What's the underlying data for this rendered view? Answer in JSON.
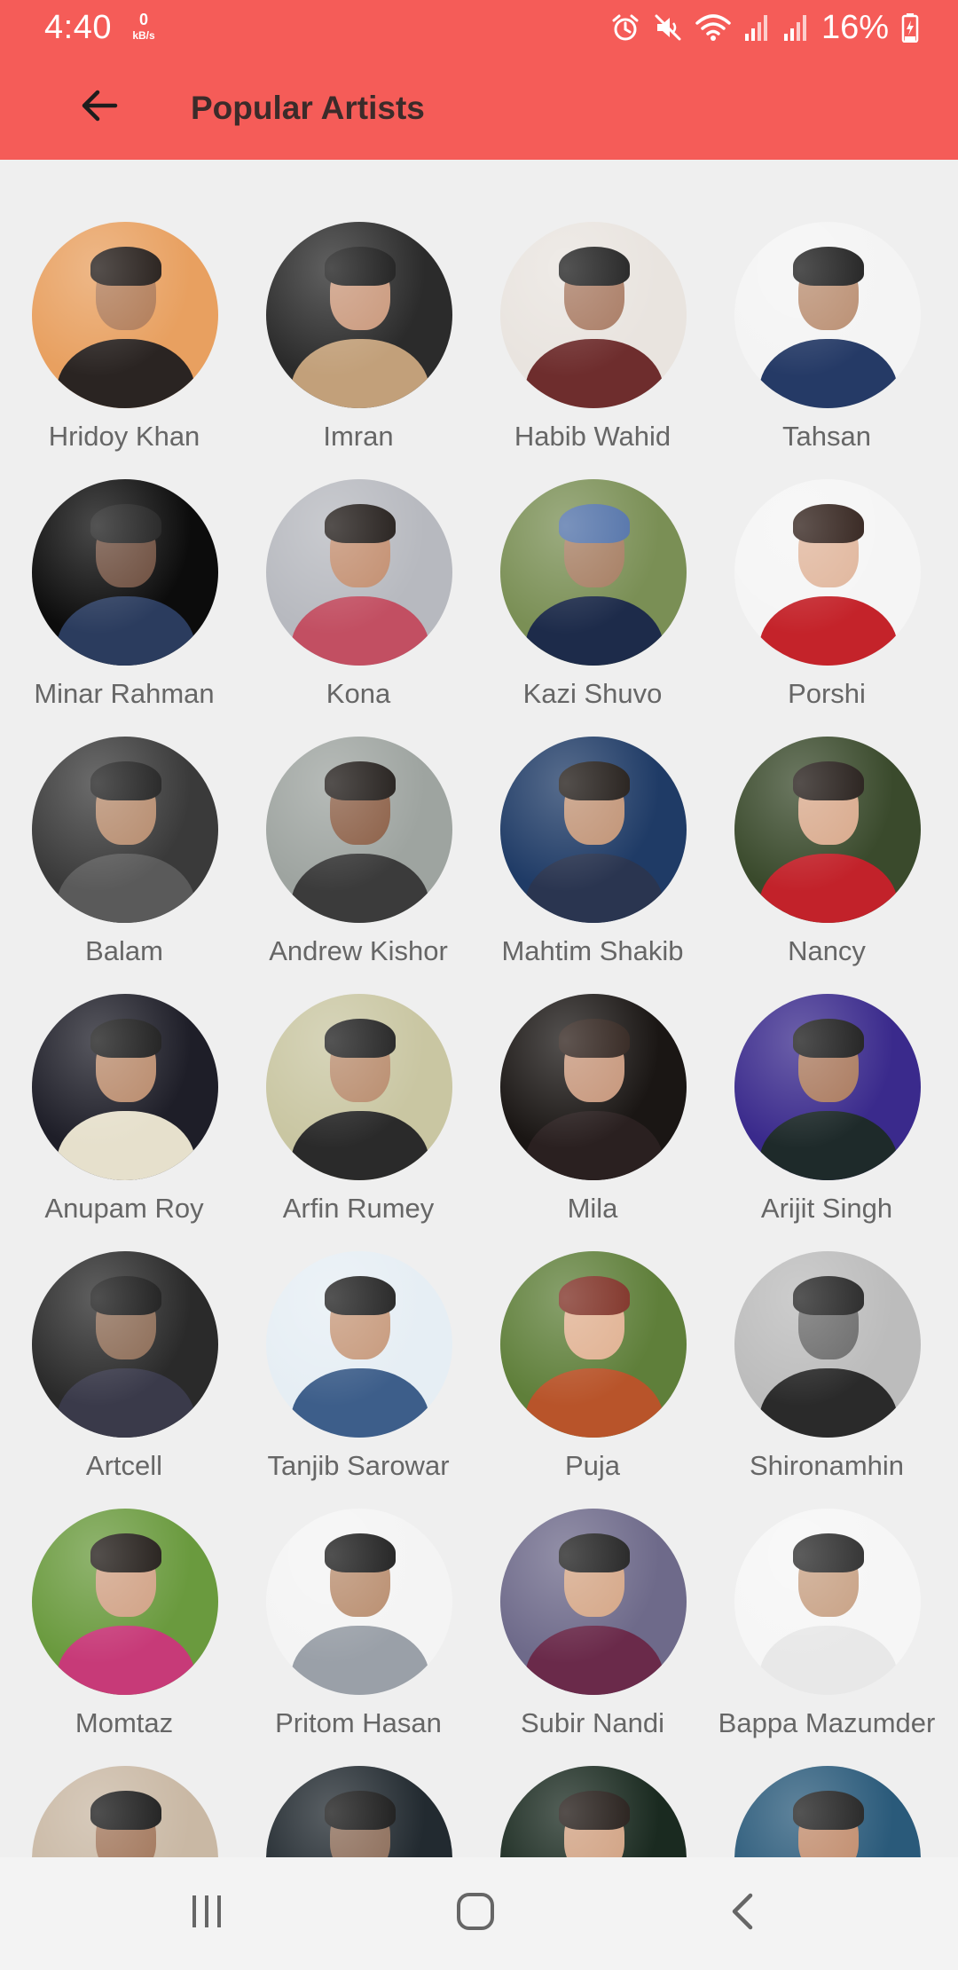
{
  "status_bar": {
    "time": "4:40",
    "net_speed_value": "0",
    "net_speed_unit": "kB/s",
    "battery": "16%",
    "icons": [
      "alarm-icon",
      "mute-icon",
      "wifi-icon",
      "signal-icon",
      "signal-icon",
      "battery-charging-icon"
    ]
  },
  "app_bar": {
    "title": "Popular Artists",
    "back_icon": "arrow-left-icon"
  },
  "artists": [
    {
      "name": "Hridoy Khan",
      "bg": "#e8a060",
      "skin": "#b07a55",
      "hair": "#1c1410",
      "cloth": "#2a2422"
    },
    {
      "name": "Imran",
      "bg": "#2b2b2b",
      "skin": "#c9977a",
      "hair": "#151515",
      "cloth": "#c2a07a"
    },
    {
      "name": "Habib Wahid",
      "bg": "#e9e4df",
      "skin": "#a87a62",
      "hair": "#1a1a1a",
      "cloth": "#6e2d2d"
    },
    {
      "name": "Tahsan",
      "bg": "#f4f4f4",
      "skin": "#b98d70",
      "hair": "#171717",
      "cloth": "#253a66"
    },
    {
      "name": "Minar Rahman",
      "bg": "#0c0c0c",
      "skin": "#6a4a3a",
      "hair": "#1a1a1a",
      "cloth": "#2b3c5e"
    },
    {
      "name": "Kona",
      "bg": "#b7b9bf",
      "skin": "#c28d6e",
      "hair": "#1b1512",
      "cloth": "#c24f62"
    },
    {
      "name": "Kazi Shuvo",
      "bg": "#7a8f55",
      "skin": "#a57c60",
      "hair": "#4d6ea6",
      "cloth": "#1d2b4a"
    },
    {
      "name": "Porshi",
      "bg": "#f5f5f5",
      "skin": "#e0b59b",
      "hair": "#2b1a14",
      "cloth": "#c4232a"
    },
    {
      "name": "Balam",
      "bg": "#3a3a3a",
      "skin": "#b58a6c",
      "hair": "#1a1a1a",
      "cloth": "#5a5a5a"
    },
    {
      "name": "Andrew Kishor",
      "bg": "#9ea4a0",
      "skin": "#8a5d44",
      "hair": "#1a1512",
      "cloth": "#3b3b3b"
    },
    {
      "name": "Mahtim Shakib",
      "bg": "#1f3b66",
      "skin": "#c09274",
      "hair": "#1a1410",
      "cloth": "#2a3550"
    },
    {
      "name": "Nancy",
      "bg": "#3a4a2c",
      "skin": "#d8a88a",
      "hair": "#1c1410",
      "cloth": "#c2222a"
    },
    {
      "name": "Anupam Roy",
      "bg": "#1e1e28",
      "skin": "#b8896a",
      "hair": "#141414",
      "cloth": "#e6e0cc"
    },
    {
      "name": "Arfin Rumey",
      "bg": "#c9c6a2",
      "skin": "#b88b6c",
      "hair": "#1a1a1a",
      "cloth": "#2a2a2a"
    },
    {
      "name": "Mila",
      "bg": "#1a1614",
      "skin": "#c59478",
      "hair": "#2a1c16",
      "cloth": "#2a2020"
    },
    {
      "name": "Arijit Singh",
      "bg": "#3a2a8c",
      "skin": "#a9785c",
      "hair": "#151515",
      "cloth": "#1e2a2a"
    },
    {
      "name": "Artcell",
      "bg": "#2a2a2a",
      "skin": "#8b6a54",
      "hair": "#141414",
      "cloth": "#3a3a4a"
    },
    {
      "name": "Tanjib Sarowar",
      "bg": "#e6eef4",
      "skin": "#c6987a",
      "hair": "#1a1a1a",
      "cloth": "#3d5e8a"
    },
    {
      "name": "Puja",
      "bg": "#5f7f3a",
      "skin": "#e0b090",
      "hair": "#7a2a1e",
      "cloth": "#b8542a"
    },
    {
      "name": "Shironamhin",
      "bg": "#bcbcbc",
      "skin": "#6a6a6a",
      "hair": "#1e1e1e",
      "cloth": "#2a2a2a"
    },
    {
      "name": "Momtaz",
      "bg": "#6a9a3e",
      "skin": "#d0a083",
      "hair": "#1a1410",
      "cloth": "#c73a78"
    },
    {
      "name": "Pritom Hasan",
      "bg": "#f4f4f4",
      "skin": "#b88c6d",
      "hair": "#161616",
      "cloth": "#9aa0a8"
    },
    {
      "name": "Subir Nandi",
      "bg": "#6e6a8a",
      "skin": "#d4a585",
      "hair": "#1a1a1a",
      "cloth": "#6a2a4a"
    },
    {
      "name": "Bappa Mazumder",
      "bg": "#f6f6f6",
      "skin": "#c7a083",
      "hair": "#262626",
      "cloth": "#e8e8e8"
    },
    {
      "name": "",
      "bg": "#c9b8a4",
      "skin": "#a07458",
      "hair": "#141414",
      "cloth": "#2a2a2a"
    },
    {
      "name": "",
      "bg": "#222a30",
      "skin": "#8a6a56",
      "hair": "#111111",
      "cloth": "#2a2a2a"
    },
    {
      "name": "",
      "bg": "#1a2a20",
      "skin": "#d0a080",
      "hair": "#1c1410",
      "cloth": "#3a2a2a"
    },
    {
      "name": "",
      "bg": "#2a5a7a",
      "skin": "#c08a6a",
      "hair": "#1a1a1a",
      "cloth": "#e8e8e8"
    }
  ],
  "nav_bar": {
    "recents_icon": "recents-icon",
    "home_icon": "home-icon",
    "back_icon": "back-chevron-icon"
  }
}
